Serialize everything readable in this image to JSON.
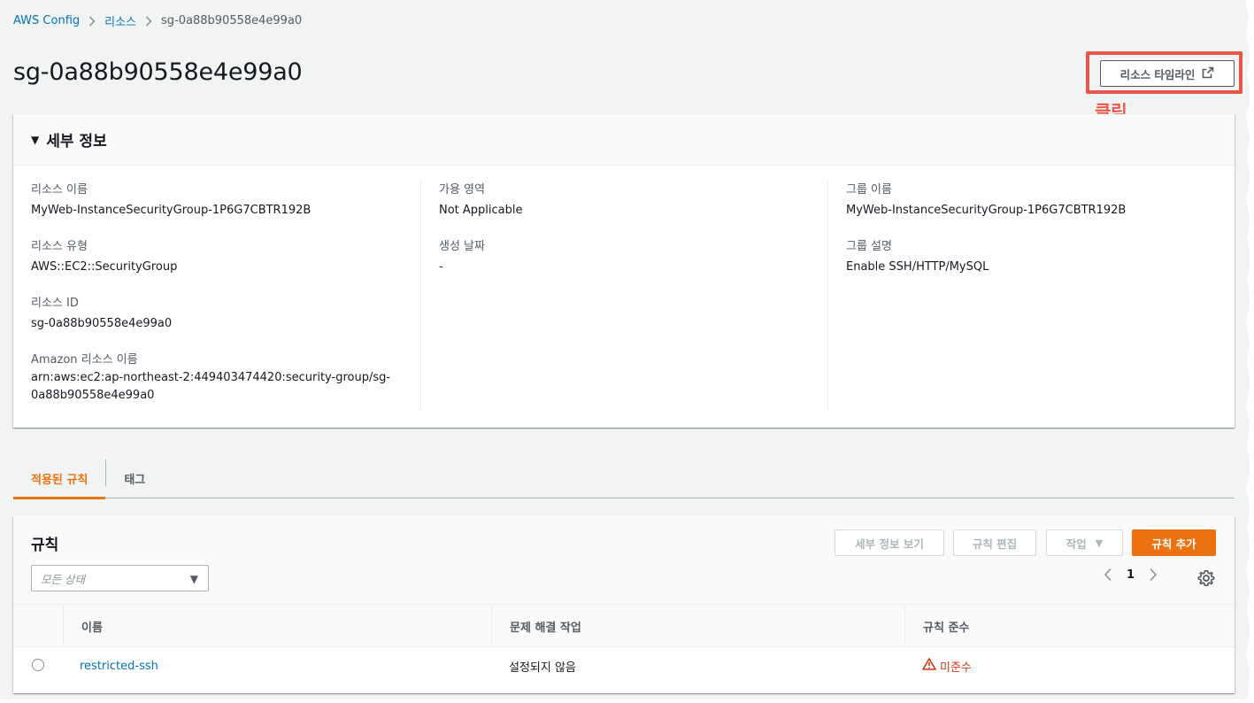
{
  "breadcrumb": {
    "root": "AWS Config",
    "resources": "리소스",
    "current": "sg-0a88b90558e4e99a0"
  },
  "page_title": "sg-0a88b90558e4e99a0",
  "header_actions": {
    "timeline_button": "리소스 타임라인",
    "annotation": "클릭"
  },
  "details": {
    "title": "세부 정보",
    "col1": [
      {
        "label": "리소스 이름",
        "value": "MyWeb-InstanceSecurityGroup-1P6G7CBTR192B"
      },
      {
        "label": "리소스 유형",
        "value": "AWS::EC2::SecurityGroup"
      },
      {
        "label": "리소스 ID",
        "value": "sg-0a88b90558e4e99a0"
      },
      {
        "label": "Amazon 리소스 이름",
        "value": "arn:aws:ec2:ap-northeast-2:449403474420:security-group/sg-0a88b90558e4e99a0"
      }
    ],
    "col2": [
      {
        "label": "가용 영역",
        "value": "Not Applicable"
      },
      {
        "label": "생성 날짜",
        "value": "-"
      }
    ],
    "col3": [
      {
        "label": "그룹 이름",
        "value": "MyWeb-InstanceSecurityGroup-1P6G7CBTR192B"
      },
      {
        "label": "그룹 설명",
        "value": "Enable SSH/HTTP/MySQL"
      }
    ]
  },
  "tabs": [
    {
      "label": "적용된 규칙",
      "active": true
    },
    {
      "label": "태그",
      "active": false
    }
  ],
  "rules": {
    "title": "규칙",
    "buttons": {
      "view_details": "세부 정보 보기",
      "edit_rule": "규칙 편집",
      "actions": "작업",
      "add_rule": "규칙 추가"
    },
    "filter": {
      "placeholder": "모든 상태"
    },
    "pagination": {
      "current_page": "1"
    },
    "columns": [
      "이름",
      "문제 해결 작업",
      "규칙 준수"
    ],
    "rows": [
      {
        "name": "restricted-ssh",
        "remediation": "설정되지 않음",
        "compliance": "미준수"
      }
    ]
  },
  "colors": {
    "accent": "#ec7211",
    "link": "#0073bb",
    "noncompliant": "#d13212",
    "highlight": "#e8564a"
  }
}
